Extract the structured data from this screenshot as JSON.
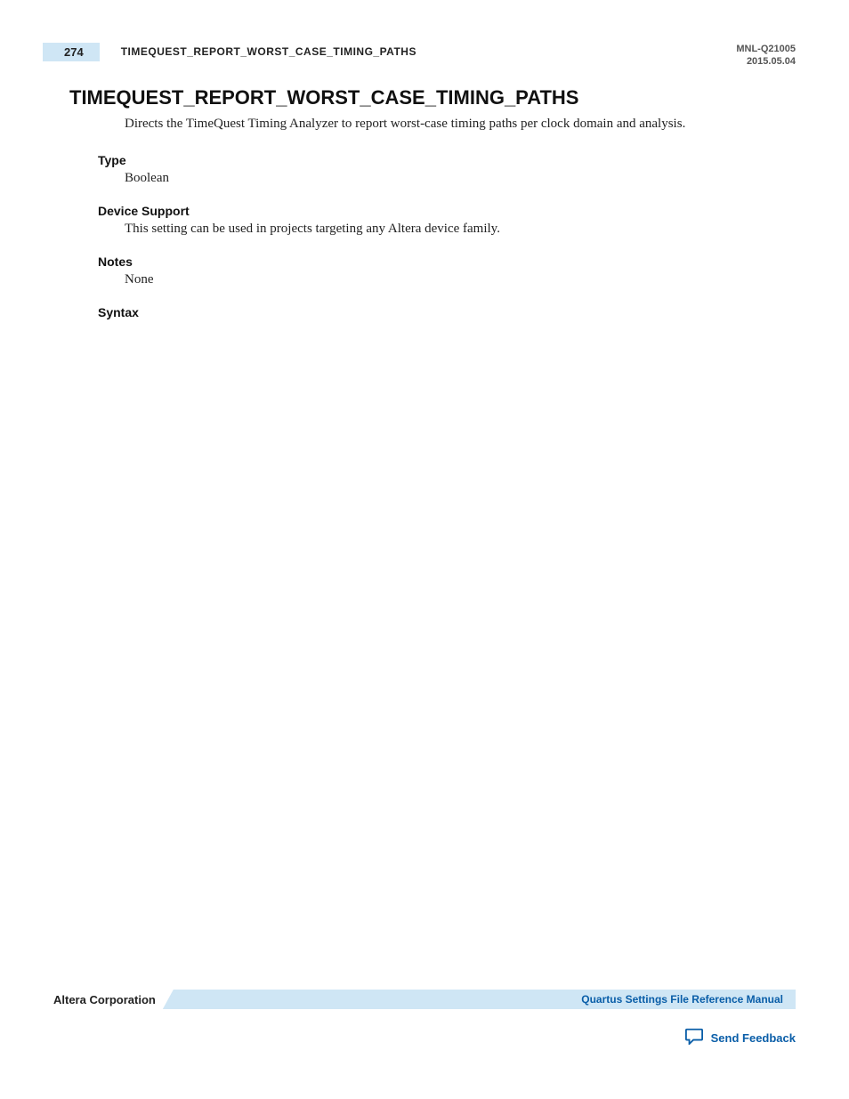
{
  "header": {
    "page_number": "274",
    "running_title": "TIMEQUEST_REPORT_WORST_CASE_TIMING_PATHS",
    "doc_id": "MNL-Q21005",
    "doc_date": "2015.05.04"
  },
  "content": {
    "title": "TIMEQUEST_REPORT_WORST_CASE_TIMING_PATHS",
    "intro": "Directs the TimeQuest Timing Analyzer to report worst-case timing paths per clock domain and analysis.",
    "sections": {
      "type_label": "Type",
      "type_body": "Boolean",
      "device_label": "Device Support",
      "device_body": "This setting can be used in projects targeting any Altera device family.",
      "notes_label": "Notes",
      "notes_body": "None",
      "syntax_label": "Syntax"
    }
  },
  "footer": {
    "corporation": "Altera Corporation",
    "manual_link": "Quartus Settings File Reference Manual",
    "feedback": "Send Feedback"
  }
}
